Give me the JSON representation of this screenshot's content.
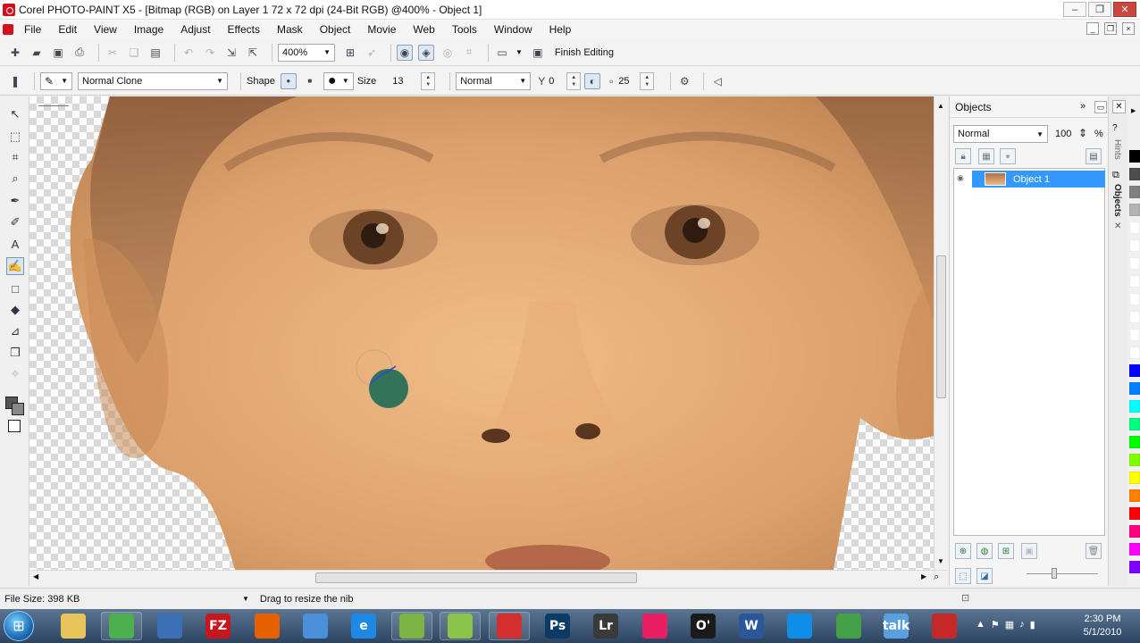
{
  "window": {
    "title": "Corel PHOTO-PAINT X5 - [Bitmap (RGB) on Layer 1 72 x 72 dpi (24-Bit RGB) @400% - Object 1]",
    "controls": [
      "‒",
      "❐",
      "✕"
    ]
  },
  "menu": {
    "items": [
      "File",
      "Edit",
      "View",
      "Image",
      "Adjust",
      "Effects",
      "Mask",
      "Object",
      "Movie",
      "Web",
      "Tools",
      "Window",
      "Help"
    ]
  },
  "standard_toolbar": {
    "zoom": "400%",
    "finish_editing": "Finish Editing"
  },
  "property_bar": {
    "clone_mode": "Normal Clone",
    "shape_label": "Shape",
    "size_label": "Size",
    "size_value": "13",
    "merge_mode": "Normal",
    "transparency_value": "0",
    "soft_edge_value": "25"
  },
  "objects_docker": {
    "title": "Objects",
    "blend_mode": "Normal",
    "opacity": "100",
    "opacity_unit": "%",
    "layers": [
      {
        "name": "Object 1",
        "visible": true,
        "selected": true
      }
    ]
  },
  "side_tabs": [
    "Hints",
    "Objects"
  ],
  "palette_colors": [
    "#000000",
    "#4d4d4d",
    "#808080",
    "#b3b3b3",
    "#ffffff",
    "#ffffff",
    "#ffffff",
    "#ffffff",
    "#ffffff",
    "#ffffff",
    "#ffffff",
    "#ffffff",
    "#0000ff",
    "#0080ff",
    "#00ffff",
    "#00ff80",
    "#00ff00",
    "#80ff00",
    "#ffff00",
    "#ff8000",
    "#ff0000",
    "#ff0080",
    "#ff00ff",
    "#8000ff"
  ],
  "status_bar": {
    "file_size": "File Size: 398 KB",
    "hint": "Drag to resize the nib"
  },
  "taskbar": {
    "apps": [
      {
        "name": "explorer",
        "label": "",
        "color": "#e8c35a"
      },
      {
        "name": "chrome",
        "label": "",
        "color": "#4caf50"
      },
      {
        "name": "thunderbird",
        "label": "",
        "color": "#3b6fb6"
      },
      {
        "name": "filezilla",
        "label": "FZ",
        "color": "#c8161d"
      },
      {
        "name": "firefox",
        "label": "",
        "color": "#e66000"
      },
      {
        "name": "safari",
        "label": "",
        "color": "#4a90d9"
      },
      {
        "name": "internet-explorer",
        "label": "e",
        "color": "#1e88e5"
      },
      {
        "name": "corel-draw",
        "label": "",
        "color": "#7cb342"
      },
      {
        "name": "corel-photo-paint-2",
        "label": "",
        "color": "#8bc34a"
      },
      {
        "name": "corel-photo-paint",
        "label": "",
        "color": "#d32f2f"
      },
      {
        "name": "photoshop",
        "label": "Ps",
        "color": "#0b3b66"
      },
      {
        "name": "lightroom",
        "label": "Lr",
        "color": "#3a3a3a"
      },
      {
        "name": "picasa",
        "label": "",
        "color": "#e91e63"
      },
      {
        "name": "oreilly",
        "label": "O'",
        "color": "#1a1a1a"
      },
      {
        "name": "word",
        "label": "W",
        "color": "#2b579a"
      },
      {
        "name": "teamviewer",
        "label": "",
        "color": "#0e8ee9"
      },
      {
        "name": "contacts",
        "label": "",
        "color": "#43a047"
      },
      {
        "name": "gtalk",
        "label": "talk",
        "color": "#5aa0e0"
      },
      {
        "name": "tweetdeck",
        "label": "",
        "color": "#c62828"
      }
    ],
    "time": "2:30 PM",
    "date": "5/1/2010"
  }
}
